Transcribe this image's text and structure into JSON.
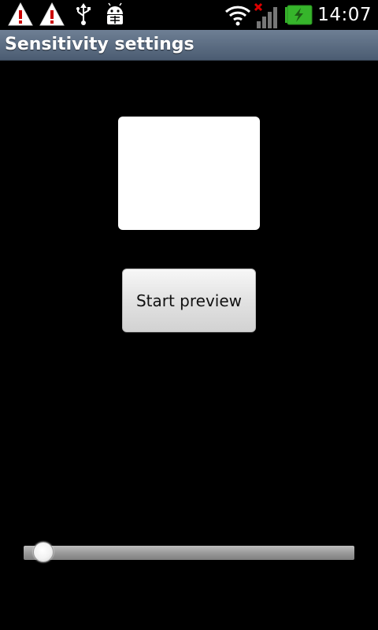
{
  "status_bar": {
    "icons_left": [
      "warning-icon",
      "warning-icon",
      "usb-icon",
      "debug-icon"
    ],
    "icons_right": [
      "wifi-icon",
      "signal-no-service-icon",
      "battery-charging-icon"
    ],
    "time": "14:07",
    "colors": {
      "warning": "#cc0000",
      "battery": "#36b52b"
    }
  },
  "title_bar": {
    "title": "Sensitivity settings"
  },
  "main": {
    "start_preview_label": "Start preview"
  },
  "slider": {
    "value_fraction": 0.03
  }
}
